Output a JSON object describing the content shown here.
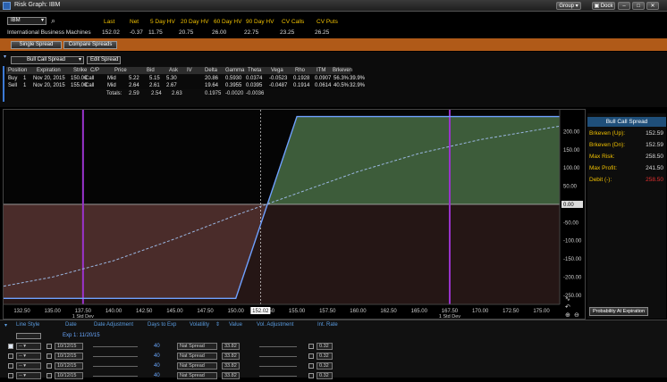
{
  "window": {
    "title": "Risk Graph: IBM",
    "group_label": "Group",
    "dock_label": "Dock"
  },
  "quote": {
    "symbol": "IBM",
    "company": "International Business Machines",
    "headers": [
      "Last",
      "Net",
      "5 Day HV",
      "20 Day HV",
      "60 Day HV",
      "90 Day HV",
      "CV Calls",
      "CV Puts"
    ],
    "values": [
      "152.02",
      "-0.37",
      "11.75",
      "20.75",
      "26.00",
      "22.75",
      "23.25",
      "26.25"
    ]
  },
  "toolbar": {
    "single_spread": "Single Spread",
    "compare_spreads": "Compare Spreads"
  },
  "strategy": {
    "selected": "Bull Call Spread",
    "edit_label": "Edit Spread",
    "columns": [
      "Position",
      "Expiration",
      "Strike",
      "C/P",
      "Price",
      "Bid",
      "Ask",
      "IV",
      "Delta",
      "Gamma",
      "Theta",
      "Vega",
      "Rho",
      "ITM",
      "Brkeven"
    ],
    "rows": [
      [
        "Buy",
        "1",
        "Nov 20, 2015",
        "150.00",
        "Call",
        "Mid",
        "5.22",
        "5.15",
        "5.30",
        "20.86",
        "0.5930",
        "0.0374",
        "-0.0523",
        "0.1928",
        "0.0907",
        "56.3%",
        "39.9%"
      ],
      [
        "Sell",
        "1",
        "Nov 20, 2015",
        "155.00",
        "Call",
        "Mid",
        "2.64",
        "2.61",
        "2.67",
        "19.64",
        "0.3955",
        "0.0395",
        "-0.0487",
        "0.1914",
        "0.0614",
        "40.5%",
        "32.9%"
      ]
    ],
    "totals": {
      "label": "Totals:",
      "price": "2.59",
      "bid": "2.54",
      "ask": "2.63",
      "delta": "0.1975",
      "gamma": "-0.0020",
      "theta": "-0.0036"
    }
  },
  "chart_data": {
    "type": "line",
    "x_ticks": [
      "132.50",
      "135.00",
      "137.50",
      "140.00",
      "142.50",
      "145.00",
      "147.50",
      "150.00",
      "152.50",
      "155.00",
      "157.50",
      "160.00",
      "162.50",
      "165.00",
      "167.50",
      "170.00",
      "172.50",
      "175.00"
    ],
    "y_ticks": [
      "200.00",
      "150.00",
      "100.00",
      "50.00",
      "0.00",
      "-50.00",
      "-100.00",
      "-150.00",
      "-200.00",
      "-250.00"
    ],
    "xlim": [
      131.0,
      176.5
    ],
    "ylim": [
      -275,
      260
    ],
    "current_price_label": "152.02",
    "std_dev_labels": [
      {
        "x": 137.5,
        "text": "1 Std Dev"
      },
      {
        "x": 167.5,
        "text": "1 Std Dev"
      }
    ],
    "series": [
      {
        "style": "expiration",
        "x": [
          131.0,
          150.0,
          155.0,
          176.5
        ],
        "y": [
          -258.5,
          -258.5,
          241.5,
          241.5
        ]
      },
      {
        "style": "current",
        "x": [
          131.0,
          135,
          140,
          145,
          150,
          152.5,
          155,
          160,
          165,
          170,
          176.5
        ],
        "y": [
          -225,
          -200,
          -155,
          -95,
          -30,
          0,
          30,
          90,
          140,
          178,
          215
        ]
      }
    ],
    "colors": {
      "profit": "#3d5c3a",
      "loss": "#4a2c2a",
      "expiration": "#6ea0ff",
      "current": "#9ab6e0",
      "std_dev": "#9a33cc"
    }
  },
  "side": {
    "title": "Bull Call Spread",
    "rows": [
      {
        "label": "Brkeven (Up):",
        "value": "152.59"
      },
      {
        "label": "Brkeven (Dn):",
        "value": "152.59"
      },
      {
        "label": "Max Risk:",
        "value": "258.50"
      },
      {
        "label": "Max Profit:",
        "value": "241.50"
      },
      {
        "label": "Debit (-):",
        "value": "258.50"
      }
    ],
    "probability_button": "Probability At Expiration"
  },
  "bottom": {
    "headers": [
      "Line Style",
      "Date",
      "Date Adjustment",
      "Days to Exp",
      "Volatility",
      "Value",
      "Vol. Adjustment",
      "Int. Rate"
    ],
    "first_row": {
      "date": "Exp 1: 11/20/15"
    },
    "rows": [
      {
        "date": "10/12/15",
        "days": "40",
        "volatility": "Nat Spread",
        "value": "33.82",
        "rate": "0.32"
      },
      {
        "date": "10/12/15",
        "days": "40",
        "volatility": "Nat Spread",
        "value": "33.82",
        "rate": "0.32"
      },
      {
        "date": "10/12/15",
        "days": "40",
        "volatility": "Nat Spread",
        "value": "33.82",
        "rate": "0.32"
      },
      {
        "date": "10/12/15",
        "days": "40",
        "volatility": "Nat Spread",
        "value": "33.82",
        "rate": "0.32"
      }
    ]
  }
}
